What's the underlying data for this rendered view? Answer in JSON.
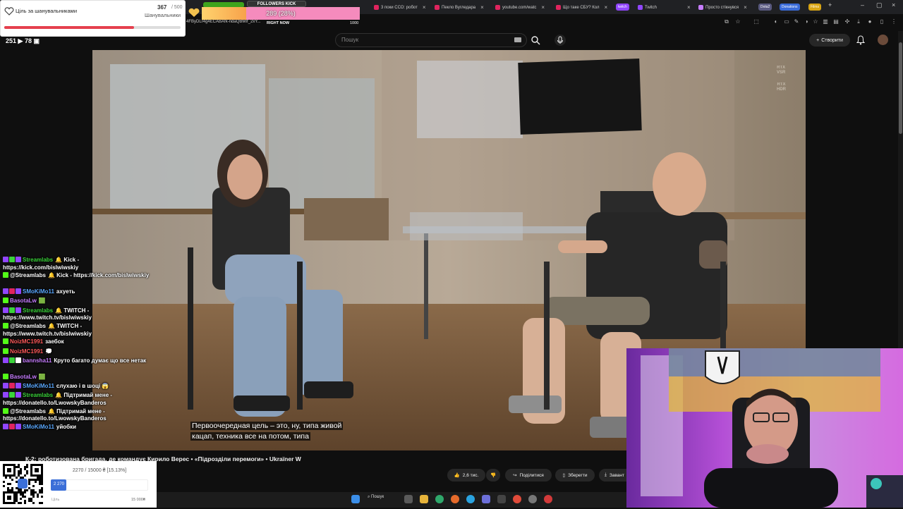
{
  "browser": {
    "tabs": [
      {
        "title": "3 поки ССО: робот"
      },
      {
        "title": "Пекло Вугледара"
      },
      {
        "title": "youtube.com/watc"
      },
      {
        "title": "Що таке СБУ? Кол"
      },
      {
        "title": "Twitch"
      },
      {
        "title": "Просто стікнувся"
      }
    ],
    "pills": [
      {
        "label": "twitch",
        "color": "#9146ff"
      },
      {
        "label": "Dota2",
        "color": "#5a5a80"
      },
      {
        "label": "Donations",
        "color": "#3a6bd8"
      },
      {
        "label": "Films",
        "color": "#d9a514"
      }
    ],
    "url_fragment": "4FByDLr4g4ECABAfk-ndaQBMIf_2xY..."
  },
  "youtube": {
    "search_placeholder": "Пошук",
    "create_label": "Створити",
    "video_title": "К-2: роботизована бригада, де командує Кирило Верес • «Підрозділи перемоги» • Ukraїner W",
    "subtitle_line1": "Первоочередная цель – это, ну, типа живой",
    "subtitle_line2": "кацап, техника все на потом, типа",
    "rtx_vsr": [
      "RTX",
      "VSR"
    ],
    "rtx_hdr": [
      "RTX",
      "HDR"
    ],
    "actions": {
      "likes": "2,6 тис.",
      "share": "Поділитися",
      "save": "Зберегти",
      "download": "Завант"
    }
  },
  "taskbar": {
    "search_label": "Пошук"
  },
  "overlay": {
    "follower_goal": {
      "title": "Ціль за шанувальниками",
      "current": "367",
      "total": "/ 500",
      "sub_label": "Шанувальники",
      "progress_fraction": 0.734
    },
    "kick_goal": {
      "label": "FOLLOWERS KICK",
      "bar_text": "289 (28%)",
      "progress_fraction": 0.28,
      "right_now": "RIGHT NOW",
      "max": "1000"
    },
    "viewers_text": "251 ▶ 78 ▣",
    "donation_goal": {
      "summary": "2270 / 15000 ₴ [15.13%]",
      "fill_label": "2 270",
      "left_label": "Ціль",
      "right_label": "15 000₴",
      "progress_fraction": 0.1513
    },
    "chat": [
      {
        "user": "Streamlabs",
        "color": "#3ad33a",
        "message": "🔔 Kick - https://kick.com/bislwiwskiy",
        "badges": [
          "#9146ff",
          "#3ad33a",
          "#9146ff"
        ]
      },
      {
        "user": "@Streamlabs",
        "color": "#ffffff",
        "message": "🔔 Kick - https://kick.com/bislwiwskiy",
        "badges": [
          "#53fc18"
        ]
      },
      {
        "user": "SMoKiMo11",
        "color": "#5aa8ff",
        "message": "ахуеть",
        "badges": [
          "#9146ff",
          "#e0245e",
          "#9146ff"
        ]
      },
      {
        "user": "BasotaLw",
        "color": "#c77dff",
        "message": "🟩",
        "badges": [
          "#53fc18"
        ]
      },
      {
        "user": "Streamlabs",
        "color": "#3ad33a",
        "message": "🔔 TWITCH - https://www.twitch.tv/bislwiwskiy",
        "badges": [
          "#9146ff",
          "#3ad33a",
          "#9146ff"
        ]
      },
      {
        "user": "@Streamlabs",
        "color": "#ffffff",
        "message": "🔔 TWITCH - https://www.twitch.tv/bislwiwskiy",
        "badges": [
          "#53fc18"
        ]
      },
      {
        "user": "NoizMC1991",
        "color": "#ff5a5a",
        "message": "заебок",
        "badges": [
          "#53fc18"
        ]
      },
      {
        "user": "NoizMC1991",
        "color": "#ff5a5a",
        "message": "💭",
        "badges": [
          "#53fc18"
        ]
      },
      {
        "user": "bannsha11",
        "color": "#c77dff",
        "message": "Круто багато думає що все нетак",
        "badges": [
          "#9146ff",
          "#3ad33a",
          "#ffffff"
        ]
      },
      {
        "user": "BasotaLw",
        "color": "#c77dff",
        "message": "🟩",
        "badges": [
          "#53fc18"
        ]
      },
      {
        "user": "SMoKiMo11",
        "color": "#5aa8ff",
        "message": "слухаю і в шоці 😱",
        "badges": [
          "#9146ff",
          "#e0245e",
          "#9146ff"
        ]
      },
      {
        "user": "Streamlabs",
        "color": "#3ad33a",
        "message": "🔔 Підтримай мене - https://donatello.to/LwowskyBanderos",
        "badges": [
          "#9146ff",
          "#3ad33a",
          "#9146ff"
        ]
      },
      {
        "user": "@Streamlabs",
        "color": "#ffffff",
        "message": "🔔 Підтримай мене - https://donatello.to/LwowskyBanderos",
        "badges": [
          "#53fc18"
        ]
      },
      {
        "user": "SMoKiMo11",
        "color": "#5aa8ff",
        "message": "уйобки",
        "badges": [
          "#9146ff",
          "#e0245e",
          "#9146ff"
        ]
      }
    ]
  },
  "colors": {
    "yt_bg": "#0f0f0f",
    "kick_green": "#53fc18",
    "twitch_purple": "#9146ff",
    "goal_red": "#e5404e",
    "donation_blue": "#3b6fd8"
  }
}
